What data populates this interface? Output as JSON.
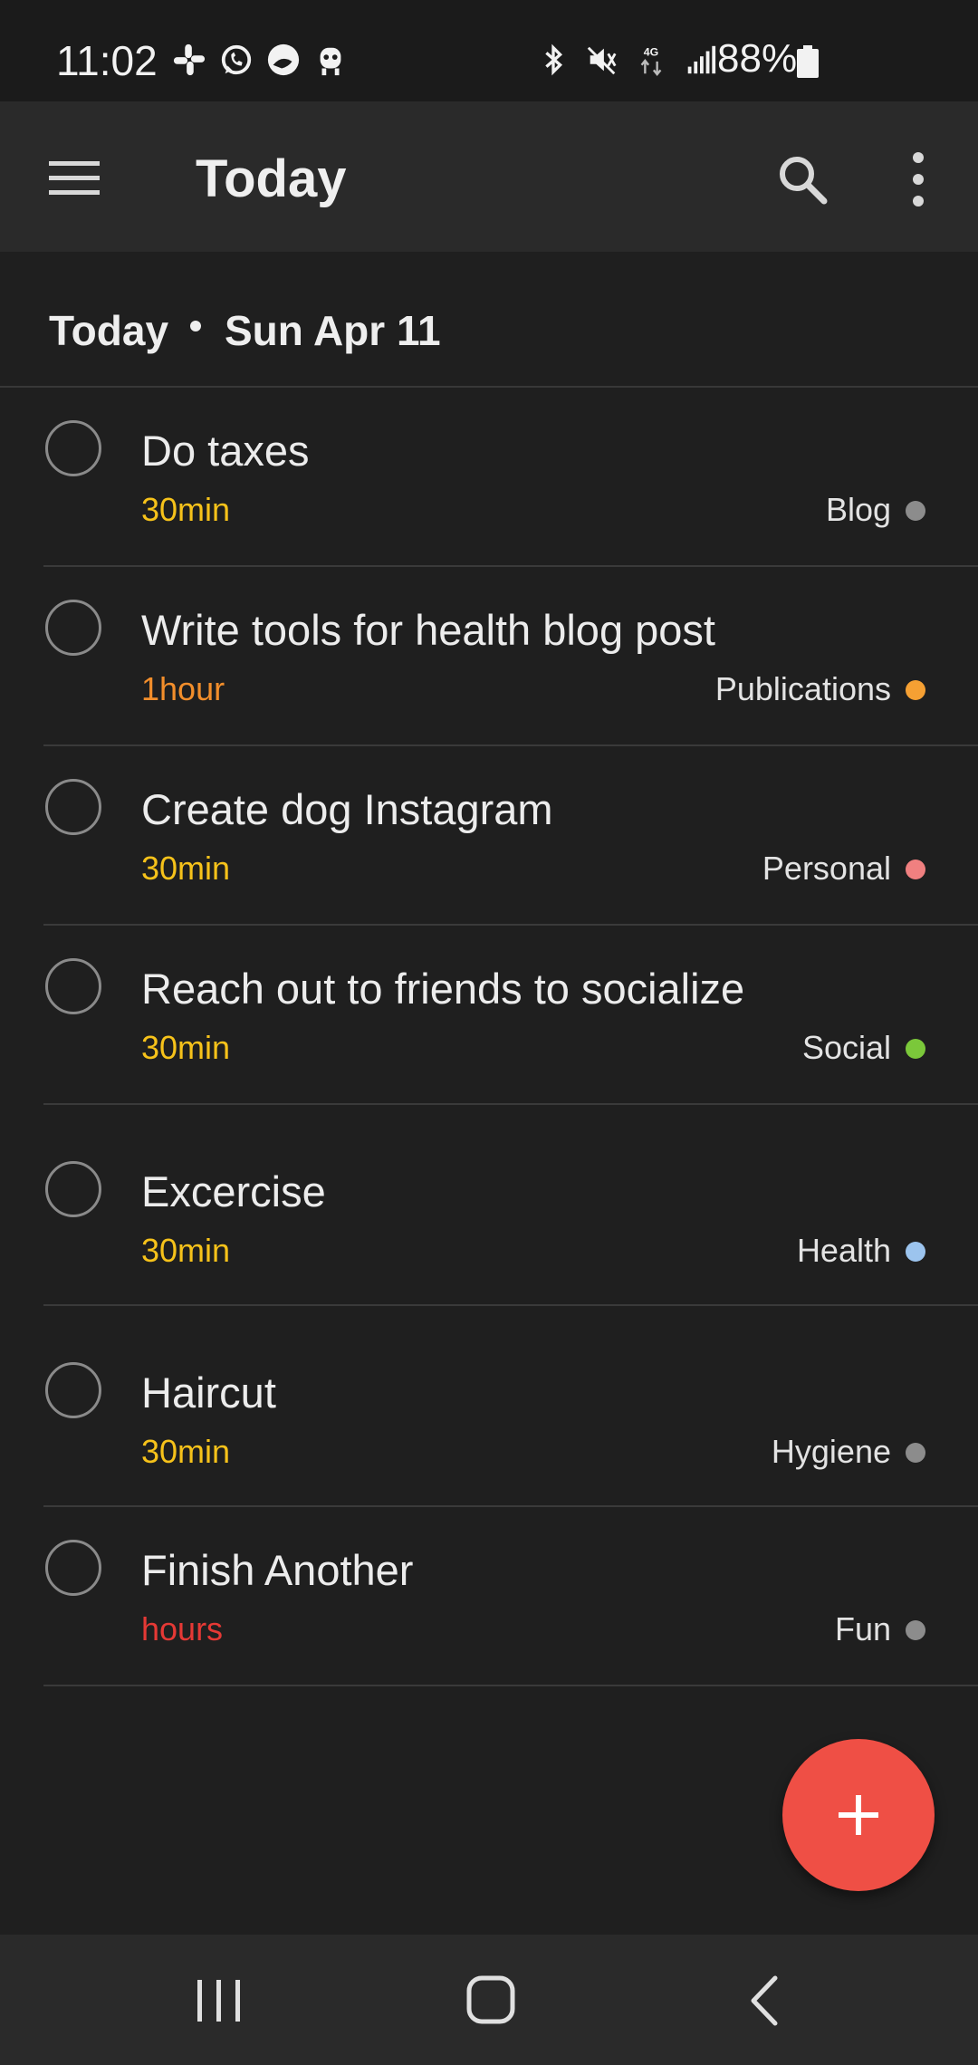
{
  "status_bar": {
    "time": "11:02",
    "left_icons": [
      "slack-icon",
      "whatsapp-icon",
      "app-icon",
      "bot-icon"
    ],
    "right_icons": [
      "bluetooth-icon",
      "mute-icon",
      "4g-lte-icon",
      "signal-icon"
    ],
    "battery_text": "88%"
  },
  "app_bar": {
    "title": "Today"
  },
  "section": {
    "label": "Today",
    "date": "Sun Apr 11"
  },
  "colors": {
    "accent": "#ef4f45",
    "duration_30min": "#f6c21a",
    "duration_1hour": "#f28e2b",
    "duration_hours": "#e53935"
  },
  "tasks": [
    {
      "title": "Do taxes",
      "duration": "30min",
      "duration_color": "#f6c21a",
      "project": "Blog",
      "project_color": "#8c8c8c"
    },
    {
      "title": "Write tools for health blog post",
      "duration": "1hour",
      "duration_color": "#f28e2b",
      "project": "Publications",
      "project_color": "#f5a033"
    },
    {
      "title": "Create dog Instagram",
      "duration": "30min",
      "duration_color": "#f6c21a",
      "project": "Personal",
      "project_color": "#f08080"
    },
    {
      "title": "Reach out to friends to socialize",
      "duration": "30min",
      "duration_color": "#f6c21a",
      "project": "Social",
      "project_color": "#7bc83a"
    },
    {
      "title": "Excercise",
      "duration": "30min",
      "duration_color": "#f6c21a",
      "project": "Health",
      "project_color": "#9cc4ee"
    },
    {
      "title": "Haircut",
      "duration": "30min",
      "duration_color": "#f6c21a",
      "project": "Hygiene",
      "project_color": "#8c8c8c"
    },
    {
      "title": "Finish Another",
      "duration": "hours",
      "duration_color": "#e53935",
      "project": "Fun",
      "project_color": "#8c8c8c"
    }
  ]
}
